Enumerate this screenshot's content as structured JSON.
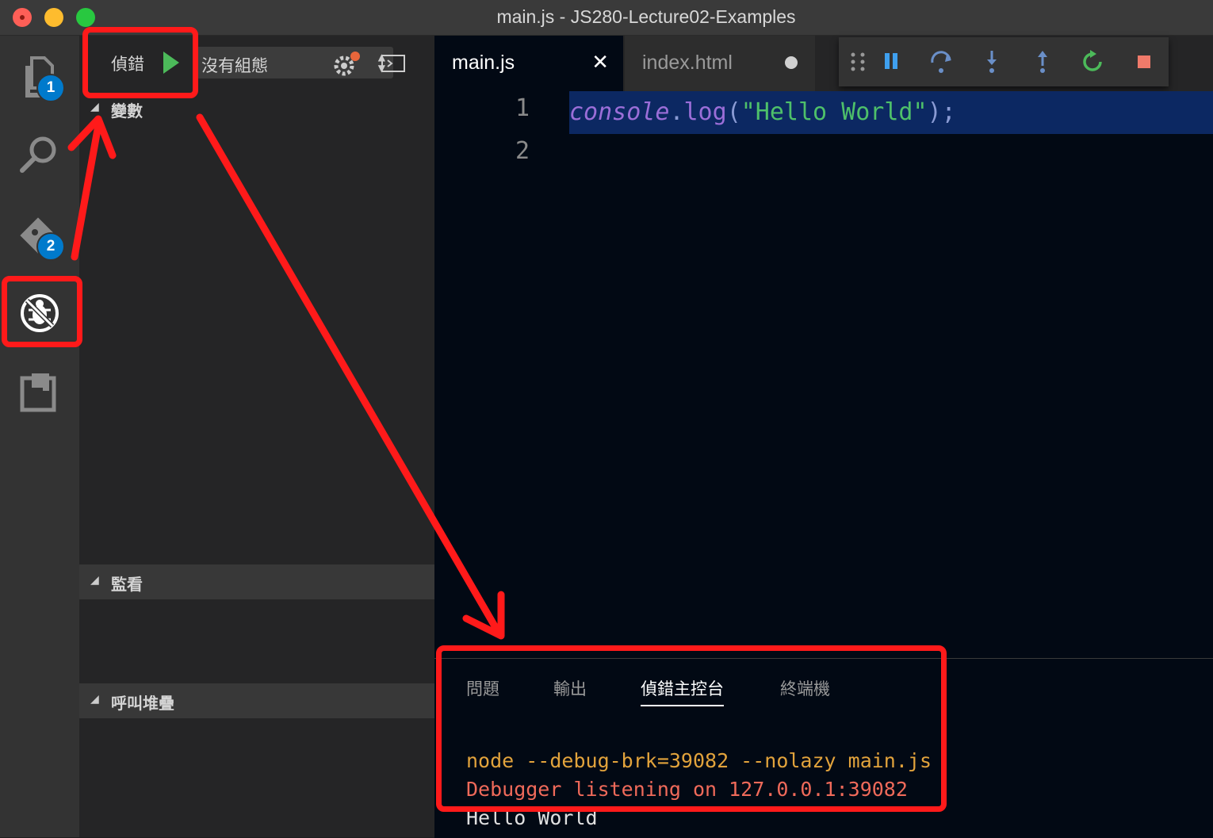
{
  "window": {
    "title": "main.js - JS280-Lecture02-Examples"
  },
  "activity_bar": {
    "explorer_badge": "1",
    "scm_badge": "2",
    "icons": [
      "files-icon",
      "search-icon",
      "git-icon",
      "debug-icon",
      "extensions-icon"
    ]
  },
  "debug_sidebar": {
    "label": "偵錯",
    "config_select": "沒有組態",
    "sections": {
      "variables": "變數",
      "watch": "監看",
      "call_stack": "呼叫堆疊"
    }
  },
  "editor": {
    "tabs": [
      {
        "label": "main.js",
        "active": true,
        "status": "close"
      },
      {
        "label": "index.html",
        "active": false,
        "status": "modified"
      }
    ],
    "line_numbers": [
      "1",
      "2"
    ],
    "code": {
      "obj": "console",
      "dot": ".",
      "fn": "log",
      "open": "(",
      "str": "\"Hello World\"",
      "close": ");"
    }
  },
  "panel": {
    "tabs": [
      "問題",
      "輸出",
      "偵錯主控台",
      "終端機"
    ],
    "active_tab": "偵錯主控台",
    "console_lines": [
      {
        "text": "node --debug-brk=39082 --nolazy main.js",
        "color": "#e2a33c"
      },
      {
        "text": "Debugger listening on 127.0.0.1:39082",
        "color": "#f06a5a"
      },
      {
        "text": "Hello World",
        "color": "#e0e0e0"
      }
    ]
  },
  "colors": {
    "annotation": "#ff1a1a",
    "accent": "#007acc",
    "code_highlight": "#0c2862"
  }
}
